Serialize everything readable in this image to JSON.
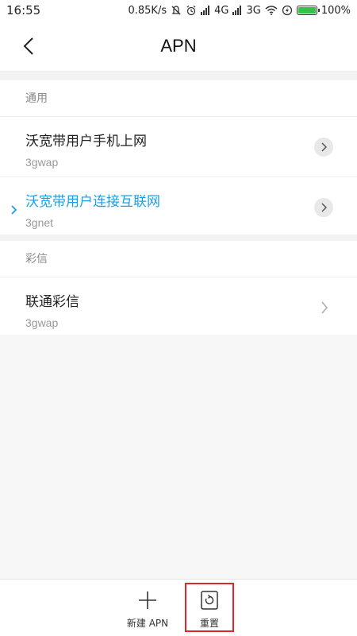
{
  "status_bar": {
    "time": "16:55",
    "net_speed": "0.85K/s",
    "network_1": "4G",
    "network_2": "3G",
    "battery": "100%"
  },
  "header": {
    "title": "APN"
  },
  "sections": [
    {
      "label": "通用",
      "items": [
        {
          "title": "沃宽带用户手机上网",
          "subtitle": "3gwap",
          "selected": false
        },
        {
          "title": "沃宽带用户连接互联网",
          "subtitle": "3gnet",
          "selected": true
        }
      ]
    },
    {
      "label": "彩信",
      "items": [
        {
          "title": "联通彩信",
          "subtitle": "3gwap",
          "selected": false
        }
      ]
    }
  ],
  "bottom_bar": {
    "new_apn_label": "新建 APN",
    "reset_label": "重置"
  },
  "colors": {
    "accent": "#1a9fe8",
    "highlight": "#e0262b",
    "battery_fill": "#35c24a"
  }
}
